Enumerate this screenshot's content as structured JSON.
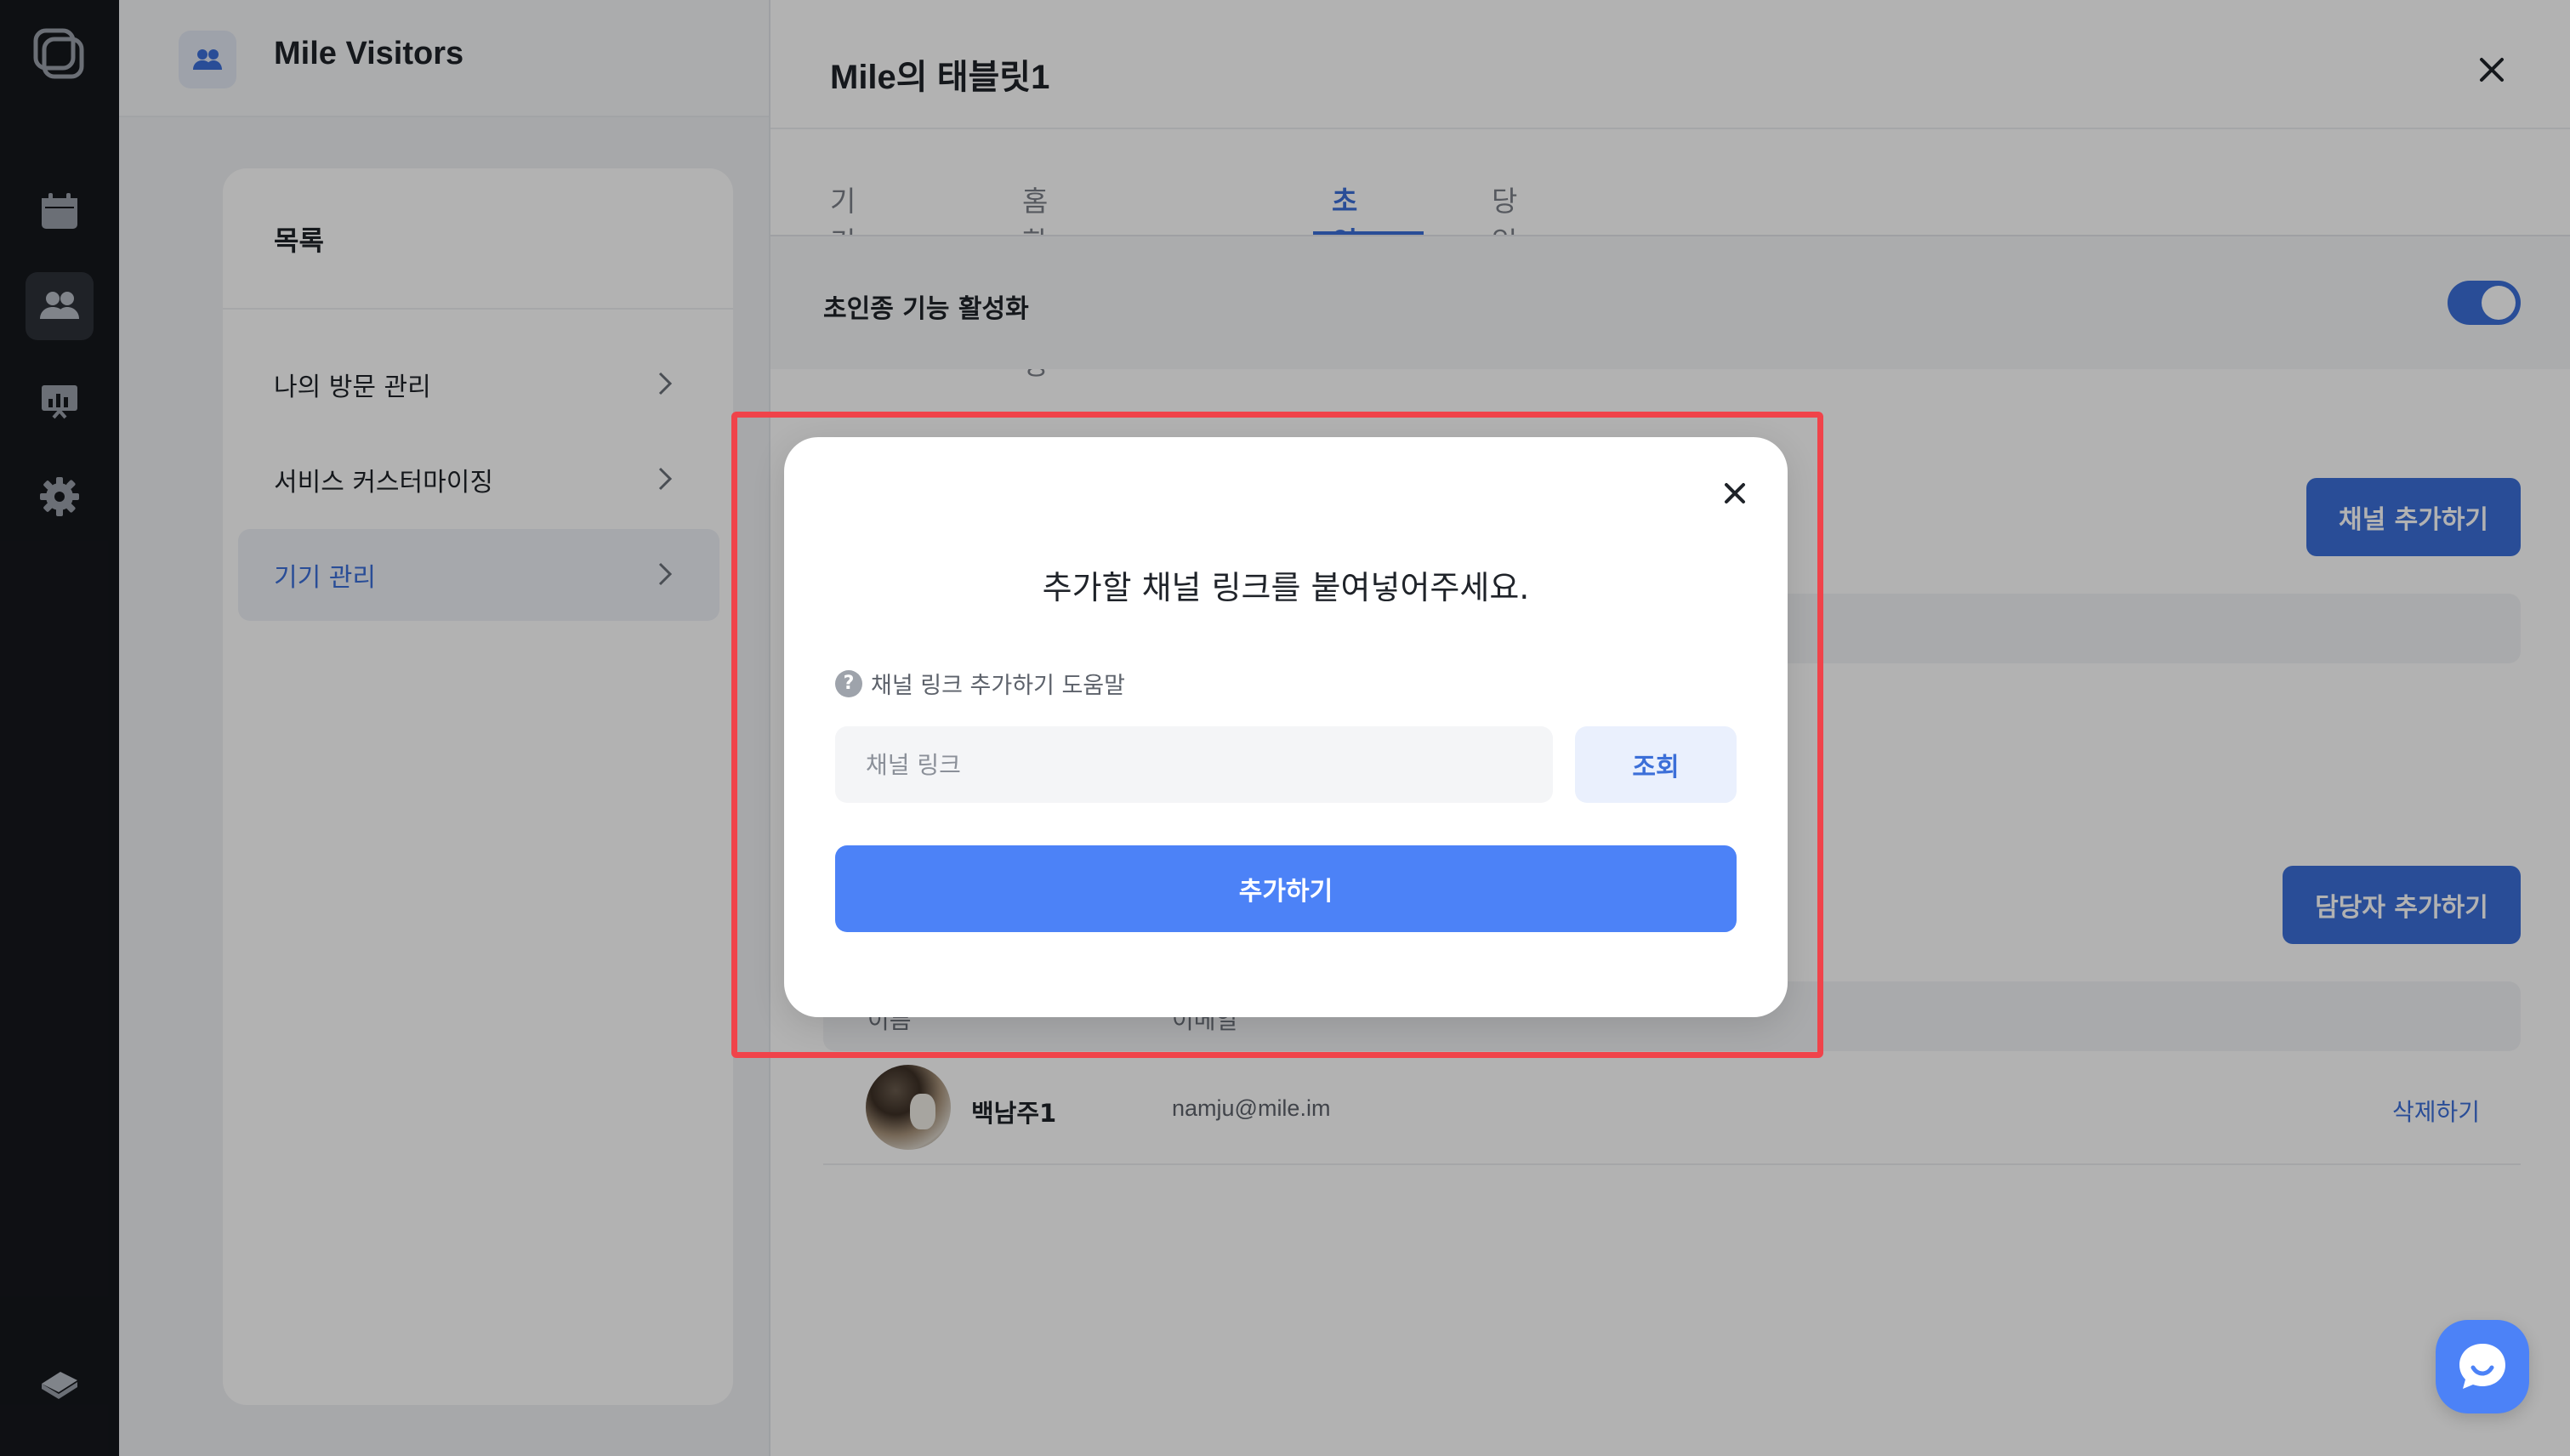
{
  "app": {
    "title": "Mile Visitors"
  },
  "sidebar": {
    "heading": "목록",
    "items": [
      {
        "label": "나의 방문 관리"
      },
      {
        "label": "서비스 커스터마이징"
      },
      {
        "label": "기기 관리"
      }
    ]
  },
  "drawer": {
    "title": "Mile의 태블릿1",
    "tabs": [
      {
        "label": "기기 정보"
      },
      {
        "label": "홈 화면 구성"
      },
      {
        "label": "초인종"
      },
      {
        "label": "당일 방문"
      }
    ],
    "active_tab": "초인종",
    "feature_label": "초인종 기능 활성화",
    "feature_enabled": true,
    "add_channel_label": "채널 추가하기",
    "add_manager_label": "담당자 추가하기",
    "columns": {
      "name": "이름",
      "email": "이메일"
    },
    "managers": [
      {
        "name": "백남주1",
        "email": "namju@mile.im",
        "action": "삭제하기"
      }
    ]
  },
  "modal": {
    "title": "추가할 채널 링크를 붙여넣어주세요.",
    "help_text": "채널 링크 추가하기 도움말",
    "input_placeholder": "채널 링크",
    "input_value": "",
    "search_label": "조회",
    "submit_label": "추가하기"
  },
  "colors": {
    "accent": "#3c6fd8",
    "primary_button": "#4c82f7",
    "highlight": "#f0434a",
    "rail_bg": "#15171c"
  }
}
